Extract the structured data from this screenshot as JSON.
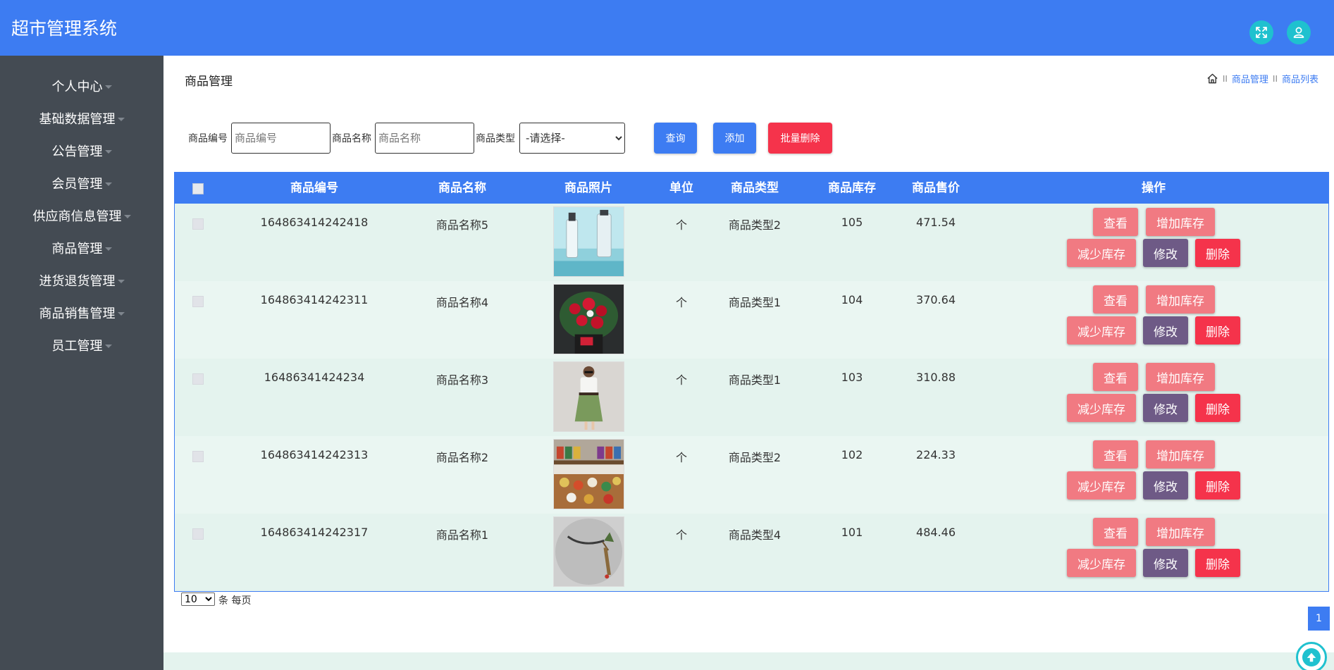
{
  "header": {
    "app_title": "超市管理系统",
    "fullscreen_icon": "expand-icon",
    "user_icon": "user-icon"
  },
  "sidebar": {
    "items": [
      {
        "label": "个人中心"
      },
      {
        "label": "基础数据管理"
      },
      {
        "label": "公告管理"
      },
      {
        "label": "会员管理"
      },
      {
        "label": "供应商信息管理"
      },
      {
        "label": "商品管理"
      },
      {
        "label": "进货退货管理"
      },
      {
        "label": "商品销售管理"
      },
      {
        "label": "员工管理"
      }
    ]
  },
  "main": {
    "page_title": "商品管理",
    "breadcrumb": [
      "商品管理",
      "商品列表"
    ],
    "breadcrumb_sep": "II"
  },
  "filters": {
    "code_label": "商品编号",
    "code_placeholder": "商品编号",
    "name_label": "商品名称",
    "name_placeholder": "商品名称",
    "type_label": "商品类型",
    "type_selected": "-请选择-",
    "query_button": "查询",
    "add_button": "添加",
    "batch_delete_button": "批量删除"
  },
  "table": {
    "headers": [
      "商品编号",
      "商品名称",
      "商品照片",
      "单位",
      "商品类型",
      "商品库存",
      "商品售价",
      "操作"
    ],
    "rows": [
      {
        "code": "164863414242418",
        "name": "商品名称5",
        "photo": "cosmetics-bottles",
        "unit": "个",
        "type": "商品类型2",
        "stock": "105",
        "price": "471.54"
      },
      {
        "code": "164863414242311",
        "name": "商品名称4",
        "photo": "rose-bouquet",
        "unit": "个",
        "type": "商品类型1",
        "stock": "104",
        "price": "370.64"
      },
      {
        "code": "16486341424234",
        "name": "商品名称3",
        "photo": "fashion-outfit",
        "unit": "个",
        "type": "商品类型1",
        "stock": "103",
        "price": "310.88"
      },
      {
        "code": "164863414242313",
        "name": "商品名称2",
        "photo": "store-shelves",
        "unit": "个",
        "type": "商品类型2",
        "stock": "102",
        "price": "224.33"
      },
      {
        "code": "164863414242317",
        "name": "商品名称1",
        "photo": "axe-item",
        "unit": "个",
        "type": "商品类型4",
        "stock": "101",
        "price": "484.46"
      }
    ],
    "actions": {
      "view": "查看",
      "add_stock": "增加库存",
      "reduce_stock": "减少库存",
      "edit": "修改",
      "delete": "删除"
    }
  },
  "pagination": {
    "page_size": "10",
    "page_size_suffix": "条 每页",
    "current_page": "1"
  },
  "colors": {
    "primary": "#3d7cf2",
    "sidebar": "#444b53",
    "accent_cyan": "#1fc1cf",
    "danger": "#f5334b",
    "pink": "#f17a82",
    "purple": "#6e5a86"
  }
}
